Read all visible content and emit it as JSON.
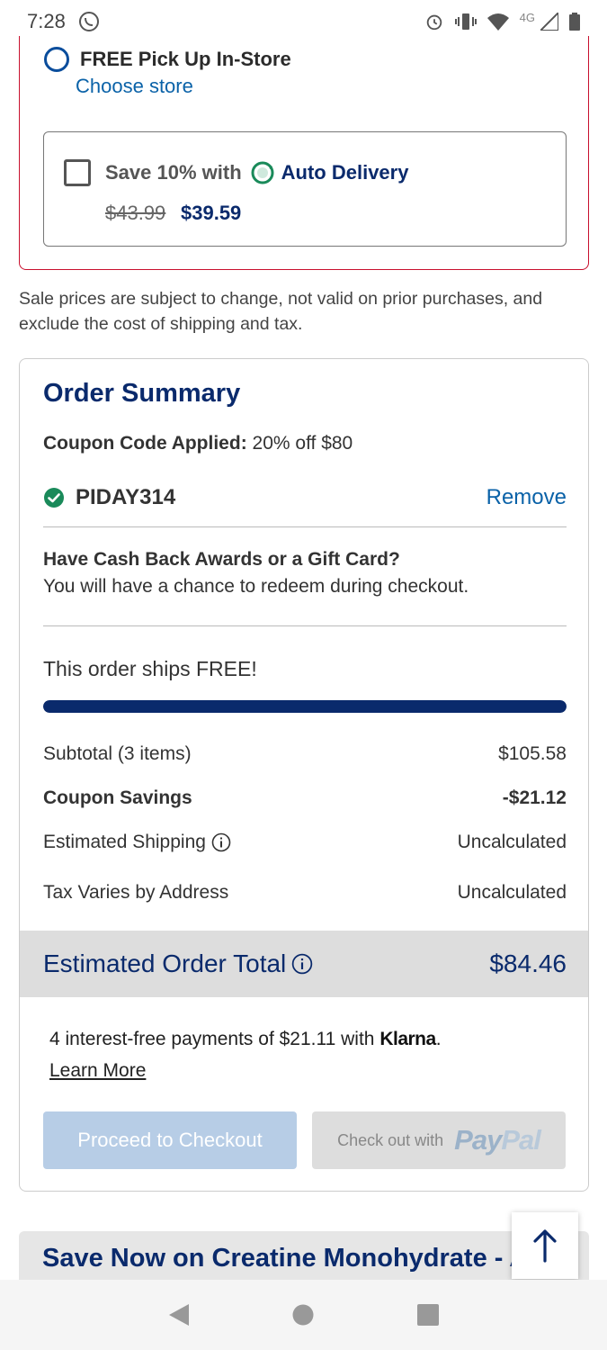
{
  "status_bar": {
    "time": "7:28",
    "network": "4G"
  },
  "fulfillment": {
    "pickup_label": "FREE Pick Up In-Store",
    "choose_store": "Choose store",
    "auto_delivery": {
      "save_text": "Save 10% with",
      "label": "Auto Delivery",
      "old_price": "$43.99",
      "new_price": "$39.59"
    }
  },
  "disclaimer": "Sale prices are subject to change, not valid on prior purchases, and exclude the cost of shipping and tax.",
  "summary": {
    "title": "Order Summary",
    "coupon_applied_label": "Coupon Code Applied:",
    "coupon_applied_value": "20% off $80",
    "coupon_code": "PIDAY314",
    "remove_label": "Remove",
    "cashback_title": "Have Cash Back Awards or a Gift Card?",
    "cashback_sub": "You will have a chance to redeem during checkout.",
    "ships_free": "This order ships FREE!",
    "shipping_progress": 1.0,
    "lines": {
      "subtotal_label": "Subtotal (3 items)",
      "subtotal_value": "$105.58",
      "coupon_label": "Coupon Savings",
      "coupon_value": "-$21.12",
      "shipping_label": "Estimated Shipping",
      "shipping_value": "Uncalculated",
      "tax_label": "Tax Varies by Address",
      "tax_value": "Uncalculated"
    },
    "total_label": "Estimated Order Total",
    "total_value": "$84.46",
    "klarna_text": "4 interest-free payments of $21.11 with",
    "klarna_brand": "Klarna",
    "klarna_period": ".",
    "learn_more": "Learn More",
    "checkout_button": "Proceed to Checkout",
    "paypal_prefix": "Check out with",
    "paypal_brand_1": "Pay",
    "paypal_brand_2": "Pal"
  },
  "next_section_title": "Save Now on Creatine Monohydrate - A",
  "colors": {
    "brand_navy": "#0a2a6c",
    "link_blue": "#0a62a8",
    "card_red": "#c8102e",
    "success_green": "#1a8a5a"
  },
  "icons": {
    "status_left": "whatsapp-icon",
    "status_right": [
      "alarm-icon",
      "vibrate-icon",
      "wifi-icon",
      "signal-icon",
      "battery-icon"
    ],
    "coupon": "check-circle-icon",
    "info": "info-icon",
    "scroll_top": "arrow-up-icon",
    "nav": [
      "back-icon",
      "home-icon",
      "recents-icon"
    ]
  }
}
